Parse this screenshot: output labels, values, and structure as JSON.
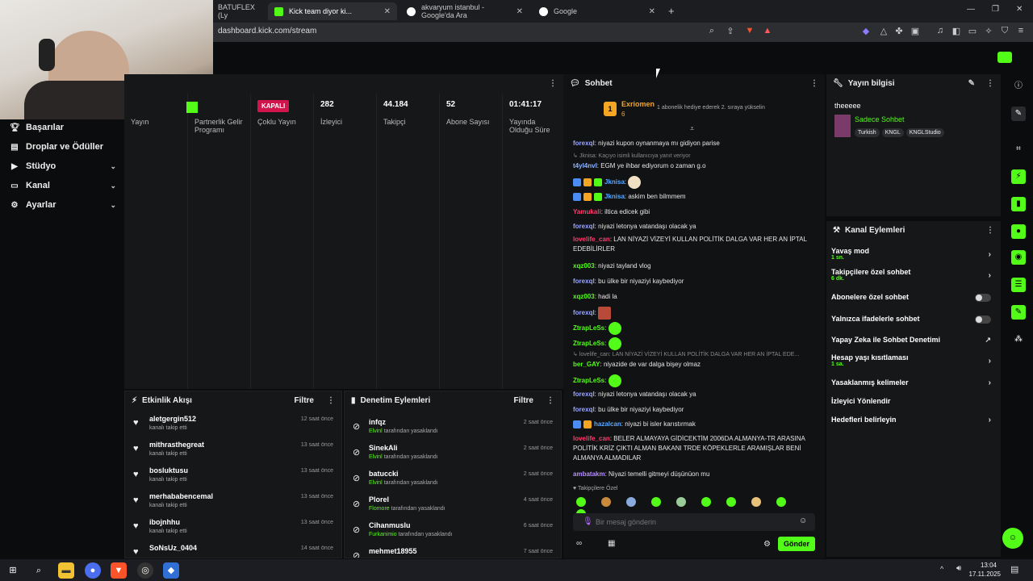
{
  "browser": {
    "tabs": [
      {
        "label": "BATUFLEX (Ly"
      },
      {
        "label": "Kick team diyor ki..."
      },
      {
        "label": "akvaryum istanbul - Google'da Ara"
      },
      {
        "label": "Google"
      }
    ],
    "url": "dashboard.kick.com/stream"
  },
  "sidebar": {
    "items": [
      {
        "label": "Başarılar"
      },
      {
        "label": "Droplar ve Ödüller"
      },
      {
        "label": "Stüdyo"
      },
      {
        "label": "Kanal"
      },
      {
        "label": "Ayarlar"
      }
    ]
  },
  "stats": [
    {
      "value": "",
      "label": "Yayın"
    },
    {
      "value": "",
      "label": "Partnerlik Gelir Programı"
    },
    {
      "value": "KAPALI",
      "label": "Çoklu Yayın"
    },
    {
      "value": "282",
      "label": "İzleyici"
    },
    {
      "value": "44.184",
      "label": "Takipçi"
    },
    {
      "value": "52",
      "label": "Abone Sayısı"
    },
    {
      "value": "01:41:17",
      "label": "Yayında Olduğu Süre"
    }
  ],
  "activity": {
    "title": "Etkinlik Akışı",
    "filter": "Filtre",
    "items": [
      {
        "name": "aletgergin512",
        "sub": "kanalı takip etti",
        "time": "12 saat önce"
      },
      {
        "name": "mithrasthegreat",
        "sub": "kanalı takip etti",
        "time": "13 saat önce"
      },
      {
        "name": "bosluktusu",
        "sub": "kanalı takip etti",
        "time": "13 saat önce"
      },
      {
        "name": "merhababencemal",
        "sub": "kanalı takip etti",
        "time": "13 saat önce"
      },
      {
        "name": "ibojnhhu",
        "sub": "kanalı takip etti",
        "time": "13 saat önce"
      },
      {
        "name": "SoNsUz_0404",
        "sub": "",
        "time": "14 saat önce"
      }
    ]
  },
  "moderation": {
    "title": "Denetim Eylemleri",
    "filter": "Filtre",
    "items": [
      {
        "name": "infqz",
        "by": "Elvinl",
        "sub": "tarafından yasaklandı",
        "time": "2 saat önce"
      },
      {
        "name": "SinekAli",
        "by": "Elvinl",
        "sub": "tarafından yasaklandı",
        "time": "2 saat önce"
      },
      {
        "name": "batuccki",
        "by": "Elvinl",
        "sub": "tarafından yasaklandı",
        "time": "2 saat önce"
      },
      {
        "name": "Plorel",
        "by": "Flomore",
        "sub": "tarafından yasaklandı",
        "time": "4 saat önce"
      },
      {
        "name": "Cihanmuslu",
        "by": "Furkanimio",
        "sub": "tarafından yasaklandı",
        "time": "6 saat önce"
      },
      {
        "name": "mehmet18955",
        "by": "",
        "sub": "",
        "time": "7 saat önce"
      }
    ]
  },
  "chat": {
    "title": "Sohbet",
    "pinned": {
      "rank": "1",
      "name": "Exriomen",
      "count": "6",
      "text": "1 abonelik hediye ederek 2. sıraya yükselin"
    },
    "messages": [
      {
        "user": "forexql",
        "color": "#9aa6ff",
        "text": "niyazi kupon oynanmaya mı gidiyon parise"
      },
      {
        "user": "Jknisa: Kaçıyo isimli kullanıcıya yanıt veriyor",
        "color": "#888",
        "text": ""
      },
      {
        "user": "t4yl4nvl",
        "color": "#8fb4ff",
        "text": "EGM ye ihbar ediyorum o zaman g.o"
      },
      {
        "user": "Jknisa",
        "color": "#5aa8ff",
        "text": ""
      },
      {
        "user": "Jknisa",
        "color": "#5aa8ff",
        "text": "askim ben bilmmem"
      },
      {
        "user": "Yamukali",
        "color": "#ff3d6e",
        "text": "iltica edicek gibi"
      },
      {
        "user": "forexql",
        "color": "#9aa6ff",
        "text": "niyazi letonya vatandaşı olacak ya"
      },
      {
        "user": "lovelife_can",
        "color": "#ff3d6e",
        "text": "LAN NİYAZİ VİZEYİ KULLAN POLİTİK DALGA VAR HER AN İPTAL EDEBİLİRLER"
      },
      {
        "user": "xqz003",
        "color": "#53fc18",
        "text": "niyazi tayland vlog"
      },
      {
        "user": "forexql",
        "color": "#9aa6ff",
        "text": "bu ülke bir niyaziyi kaybediyor"
      },
      {
        "user": "xqz003",
        "color": "#53fc18",
        "text": "hadi la"
      },
      {
        "user": "forexql",
        "color": "#9aa6ff",
        "text": ""
      },
      {
        "user": "ZtrapLeSs",
        "color": "#53fc18",
        "text": ""
      },
      {
        "user": "ZtrapLeSs",
        "color": "#53fc18",
        "text": ""
      },
      {
        "user": "lovelife_can: LAN NİYAZİ VİZEYİ KULLAN POLİTİK DALGA VAR HER AN İPTAL EDE...",
        "color": "#888",
        "text": ""
      },
      {
        "user": "ber_GAY",
        "color": "#53fc18",
        "text": "niyazide de var dalga bişey olmaz"
      },
      {
        "user": "ZtrapLeSs",
        "color": "#53fc18",
        "text": ""
      },
      {
        "user": "forexql",
        "color": "#9aa6ff",
        "text": "niyazi letonya vatandaşı olacak ya"
      },
      {
        "user": "forexql",
        "color": "#9aa6ff",
        "text": "bu ülke bir niyaziyi kaybediyor"
      },
      {
        "user": "hazalcan",
        "color": "#5aa8ff",
        "text": "niyazi bi isler karıstırmak"
      },
      {
        "user": "lovelife_can",
        "color": "#ff3d6e",
        "text": "BELER ALMAYAYA GİDİCEKTİM 2006DA ALMANYA-TR ARASINA POLİTİK KRİZ ÇIKTI ALMAN BAKANI TRDE KÖPEKLERLE ARAMIŞLAR BENİ ALMANYA ALMADILAR"
      },
      {
        "user": "ambatakm",
        "color": "#b88cff",
        "text": "Niyazi temelli gitmeyi düşünüon mu"
      }
    ],
    "followers_only": "Takipçilere Özel",
    "placeholder": "Bir mesaj gönderin",
    "send": "Gönder"
  },
  "info": {
    "title": "Yayın bilgisi",
    "stream_title": "theeeee",
    "category": "Sadece Sohbet",
    "tags": [
      "Turkish",
      "KNGL",
      "KNGLStudio"
    ]
  },
  "actions": {
    "title": "Kanal Eylemleri",
    "items": [
      {
        "label": "Yavaş mod",
        "sub": "1 sn."
      },
      {
        "label": "Takipçilere özel sohbet",
        "sub": "6 dk."
      },
      {
        "label": "Abonelere özel sohbet",
        "sub": ""
      },
      {
        "label": "Yalnızca ifadelerle sohbet",
        "sub": ""
      },
      {
        "label": "Yapay Zeka ile Sohbet Denetimi",
        "sub": ""
      },
      {
        "label": "Hesap yaşı kısıtlaması",
        "sub": "1 sa."
      },
      {
        "label": "Yasaklanmış kelimeler",
        "sub": ""
      },
      {
        "label": "İzleyici Yönlendir",
        "sub": ""
      },
      {
        "label": "Hedefleri belirleyin",
        "sub": ""
      }
    ]
  },
  "taskbar": {
    "time": "13:04",
    "date": "17.11.2025"
  },
  "colors": {
    "accent": "#53fc18",
    "danger": "#d1154c"
  }
}
